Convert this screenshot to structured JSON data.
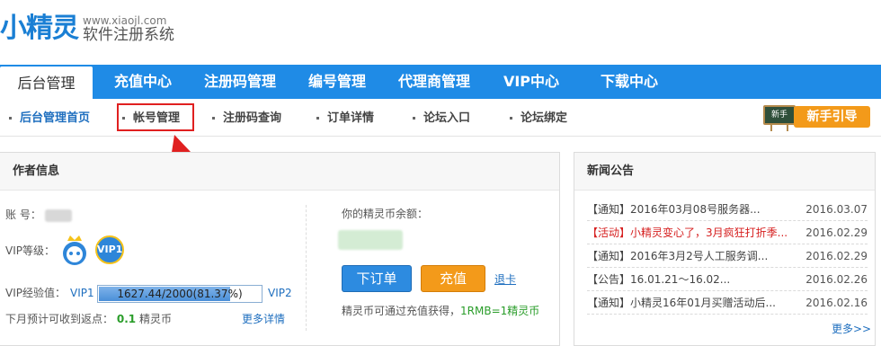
{
  "header": {
    "logo_text": "小精灵",
    "url": "www.xiaojl.com",
    "subtitle": "软件注册系统"
  },
  "nav": {
    "items": [
      "后台管理",
      "充值中心",
      "注册码管理",
      "编号管理",
      "代理商管理",
      "VIP中心",
      "下载中心"
    ],
    "active": "后台管理"
  },
  "subnav": {
    "items": [
      "后台管理首页",
      "帐号管理",
      "注册码查询",
      "订单详情",
      "论坛入口",
      "论坛绑定"
    ],
    "current": "后台管理首页",
    "highlighted": "帐号管理",
    "guide_board": "新手",
    "guide_label": "新手引导"
  },
  "author": {
    "title": "作者信息",
    "account_label": "账 号：",
    "vip_level_label": "VIP等级：",
    "vip_badge": "VIP1",
    "vip_exp_label": "VIP经验值：",
    "vip_from": "VIP1",
    "vip_to": "VIP2",
    "progress_text": "1627.44/2000(81.37%)",
    "progress_fraction": 0.8137,
    "rebate_prefix": "下月预计可收到返点：",
    "rebate_value": "0.1",
    "rebate_suffix": "精灵币",
    "more_details": "更多详情",
    "balance_label": "你的精灵币余额：",
    "order_button": "下订单",
    "charge_button": "充值",
    "refund_link": "退卡",
    "note_prefix": "精灵币可通过充值获得，",
    "note_rate": "1RMB=1精灵币"
  },
  "news": {
    "title": "新闻公告",
    "items": [
      {
        "title": "【通知】2016年03月08号服务器...",
        "date": "2016.03.07",
        "highlight": false
      },
      {
        "title": "【活动】小精灵变心了，3月疯狂打折季...",
        "date": "2016.02.29",
        "highlight": true
      },
      {
        "title": "【通知】2016年3月2号人工服务调...",
        "date": "2016.02.29",
        "highlight": false
      },
      {
        "title": "【公告】16.01.21～16.02...",
        "date": "2016.02.26",
        "highlight": false
      },
      {
        "title": "【通知】小精灵16年01月买赠活动后...",
        "date": "2016.02.16",
        "highlight": false
      }
    ],
    "more": "更多>>"
  },
  "colors": {
    "nav_bg": "#1f8be6",
    "accent": "#1f6fbf",
    "orange": "#f39a1a",
    "red": "#d62020"
  }
}
